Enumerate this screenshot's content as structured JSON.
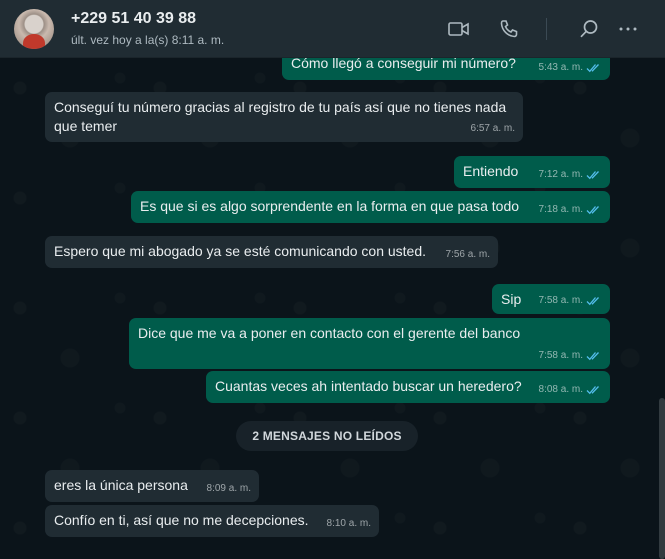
{
  "header": {
    "contact_name": "+229 51 40 39 88",
    "status": "últ. vez hoy a la(s) 8:11 a. m.",
    "icons": [
      "video-call-icon",
      "voice-call-icon",
      "search-icon",
      "more-options-icon"
    ]
  },
  "colors": {
    "header_bg": "#202c33",
    "chat_bg": "#0b141a",
    "incoming_bubble": "#202c33",
    "outgoing_bubble": "#005c4b",
    "read_ticks": "#53bdeb"
  },
  "messages": [
    {
      "direction": "out",
      "text": "Cómo llegó a conseguir mi número?",
      "time": "5:43 a. m.",
      "read": true
    },
    {
      "direction": "in",
      "text": "Conseguí tu número gracias al registro de tu país así que no tienes nada que temer",
      "time": "6:57 a. m."
    },
    {
      "direction": "out",
      "text": "Entiendo",
      "time": "7:12 a. m.",
      "read": true
    },
    {
      "direction": "out",
      "text": "Es que si es algo sorprendente en la forma en que pasa todo",
      "time": "7:18 a. m.",
      "read": true
    },
    {
      "direction": "in",
      "text": "Espero que mi abogado ya se esté comunicando con usted.",
      "time": "7:56 a. m."
    },
    {
      "direction": "out",
      "text": "Sip",
      "time": "7:58 a. m.",
      "read": true
    },
    {
      "direction": "out",
      "text": "Dice que me va a poner en contacto con el gerente del banco",
      "time": "7:58 a. m.",
      "read": true
    },
    {
      "direction": "out",
      "text": "Cuantas veces ah intentado buscar un heredero?",
      "time": "8:08 a. m.",
      "read": true
    },
    {
      "direction": "in",
      "text": "eres la única persona",
      "time": "8:09 a. m."
    },
    {
      "direction": "in",
      "text": "Confío en ti, así que no me decepciones.",
      "time": "8:10 a. m."
    }
  ],
  "unread_divider": "2 MENSAJES NO LEÍDOS"
}
